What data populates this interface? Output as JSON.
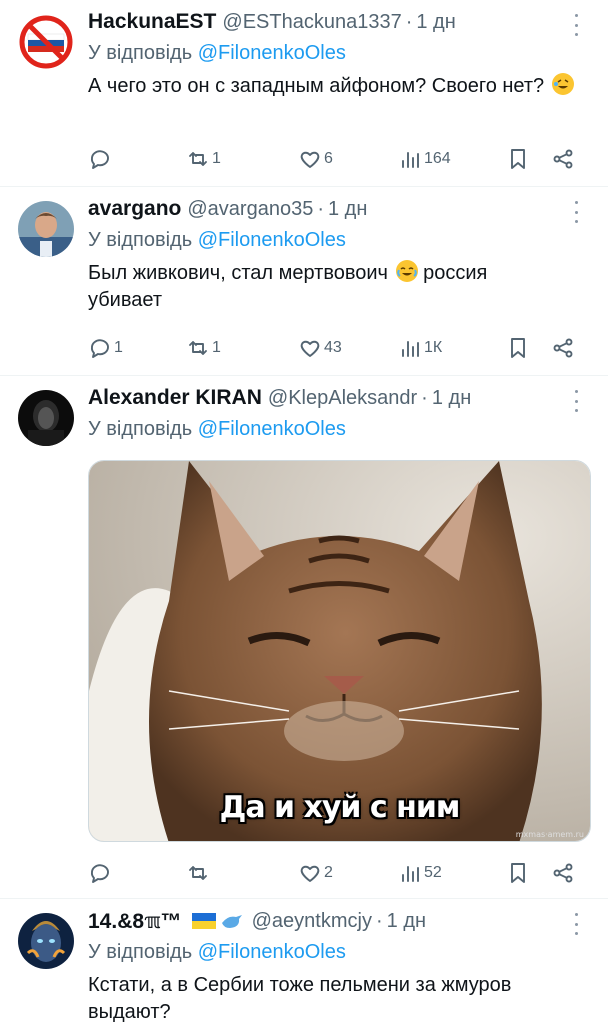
{
  "tweets": [
    {
      "name": "HackunaEST",
      "handle": "@ESThackuna1337",
      "time": "1 дн",
      "reply_prefix": "У відповідь",
      "reply_to": "@FilonenkoOles",
      "text": "А чего это он с западным айфоном? Своего нет?",
      "emoji": "rolling-laughing-emoji",
      "stats": {
        "reply": "",
        "retweet": "1",
        "like": "6",
        "views": "164"
      }
    },
    {
      "name": "avargano",
      "handle": "@avargano35",
      "time": "1 дн",
      "reply_prefix": "У відповідь",
      "reply_to": "@FilonenkoOles",
      "text_line1": "Был живкович, стал мертвовоич",
      "text_line1_end": "россия",
      "text_line2": "убивает",
      "emoji": "tears-of-joy-emoji",
      "stats": {
        "reply": "1",
        "retweet": "1",
        "like": "43",
        "views": "1К"
      }
    },
    {
      "name": "Alexander KIRAN",
      "handle": "@KlepAleksandr",
      "time": "1 дн",
      "reply_prefix": "У відповідь",
      "reply_to": "@FilonenkoOles",
      "media_caption": "Да и хуй с ним",
      "watermark": "mxmas·amem.ru",
      "stats": {
        "reply": "",
        "retweet": "",
        "like": "2",
        "views": "52"
      }
    },
    {
      "name": "14.&8ℼ™",
      "handle": "@aeyntkmcjy",
      "time": "1 дн",
      "reply_prefix": "У відповідь",
      "reply_to": "@FilonenkoOles",
      "text": "Кстати, а в Сербии тоже пельмени за жмуров выдают?",
      "flag_emoji": "ukraine-flag-emoji",
      "bird_emoji": "blue-bird-emoji"
    }
  ],
  "colors": {
    "link": "#1d9bf0",
    "muted": "#536471",
    "text": "#0f1419",
    "divider": "#eff3f4"
  }
}
